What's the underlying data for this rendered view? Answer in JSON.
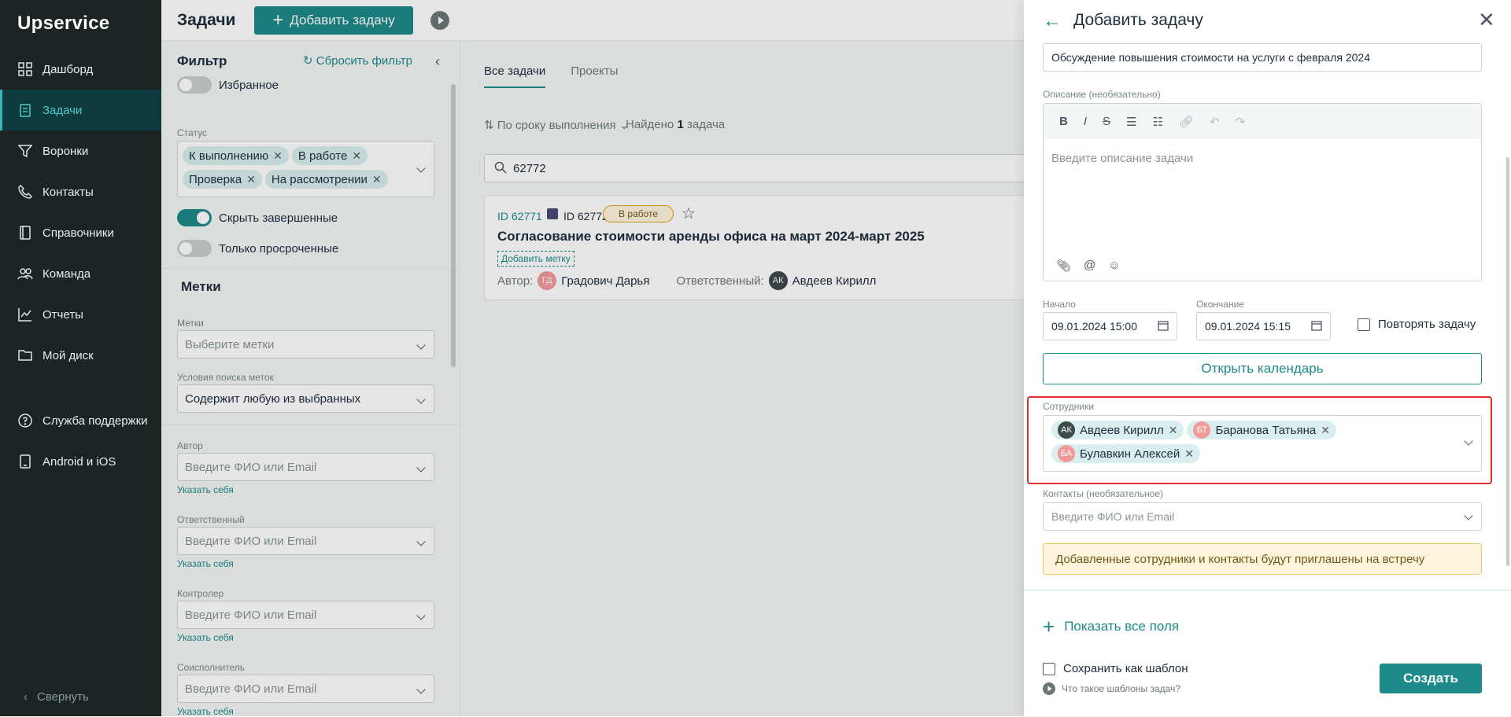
{
  "app": {
    "brand": "Upservice"
  },
  "sidebar": {
    "items": [
      {
        "label": "Дашборд",
        "icon": "dashboard-icon"
      },
      {
        "label": "Задачи",
        "icon": "tasks-icon",
        "active": true
      },
      {
        "label": "Воронки",
        "icon": "funnel-icon"
      },
      {
        "label": "Контакты",
        "icon": "phone-icon"
      },
      {
        "label": "Справочники",
        "icon": "book-icon"
      },
      {
        "label": "Команда",
        "icon": "team-icon"
      },
      {
        "label": "Отчеты",
        "icon": "chart-icon"
      },
      {
        "label": "Мой диск",
        "icon": "folder-icon"
      },
      {
        "label": "Служба поддержки",
        "icon": "help-icon"
      },
      {
        "label": "Android и iOS",
        "icon": "mobile-icon"
      }
    ],
    "collapse_label": "Свернуть"
  },
  "topbar": {
    "title": "Задачи",
    "add_label": "Добавить задачу"
  },
  "filter": {
    "title": "Фильтр",
    "reset": "Сбросить фильтр",
    "favorites": "Избранное",
    "status_label": "Статус",
    "statuses": [
      "К выполнению",
      "В работе",
      "Проверка",
      "На рассмотрении"
    ],
    "hide_done": "Скрыть завершенные",
    "only_overdue": "Только просроченные",
    "tags_section": "Метки",
    "tags_label": "Метки",
    "tags_placeholder": "Выберите метки",
    "cond_label": "Условия поиска меток",
    "cond_value": "Содержит любую из выбранных",
    "author_label": "Автор",
    "responsible_label": "Ответственный",
    "controller_label": "Контролер",
    "coexec_label": "Соисполнитель",
    "person_placeholder": "Введите ФИО или Email",
    "set_me": "Указать себя"
  },
  "content": {
    "tabs": [
      "Все задачи",
      "Проекты"
    ],
    "sort": "По сроку выполнения",
    "found_prefix": "Найдено",
    "found_count": "1",
    "found_suffix": "задача",
    "search_value": "62772",
    "card": {
      "id1": "ID 62771",
      "id2": "ID 62772",
      "status": "В работе",
      "title": "Согласование стоимости аренды офиса на март 2024-март 2025",
      "add_tag": "Добавить метку",
      "author_label": "Автор:",
      "author_initials": "ГД",
      "author": "Градович Дарья",
      "resp_label": "Ответственный:",
      "resp_initials": "АК",
      "resp": "Авдеев Кирилл"
    }
  },
  "panel": {
    "title": "Добавить задачу",
    "name_value": "Обсуждение повышения стоимости на услуги с февраля 2024",
    "desc_label": "Описание (необязательно)",
    "desc_placeholder": "Введите описание задачи",
    "start_label": "Начало",
    "start_value": "09.01.2024 15:00",
    "end_label": "Окончание",
    "end_value": "09.01.2024 15:15",
    "repeat_label": "Повторять задачу",
    "calendar_btn": "Открыть календарь",
    "employees_label": "Сотрудники",
    "employees": [
      {
        "initials": "АК",
        "name": "Авдеев Кирилл",
        "color": "#3f4a4a"
      },
      {
        "initials": "БТ",
        "name": "Баранова Татьяна",
        "color": "#f29a9a"
      },
      {
        "initials": "БА",
        "name": "Булавкин Алексей",
        "color": "#f29a9a"
      }
    ],
    "contacts_label": "Контакты (необязательное)",
    "contacts_placeholder": "Введите ФИО или Email",
    "notice": "Добавленные сотрудники и контакты будут приглашены на встречу",
    "show_all": "Показать все поля",
    "save_template": "Сохранить как шаблон",
    "what_templates": "Что такое шаблоны задач?",
    "create": "Создать"
  },
  "colors": {
    "accent": "#1f8a8a",
    "sidebar_bg": "#1d2424",
    "highlight": "#e02d2d"
  }
}
